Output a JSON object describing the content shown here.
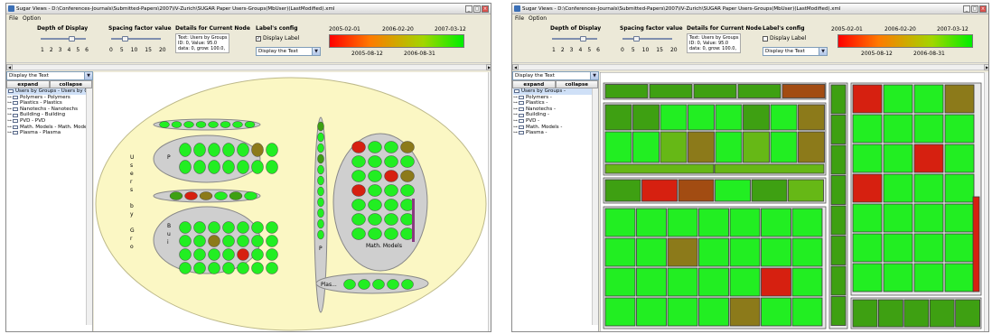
{
  "windows": [
    {
      "title": "Sugar Views - D:\\Conferences-Journals\\Submitted-Papers\\2007\\IV-Zurich\\SUGAR Paper Users-Groups(MbUser)(LastModified).xml",
      "menu": [
        "File",
        "Option"
      ],
      "depth": {
        "title": "Depth of Display",
        "ticks": [
          "1",
          "2",
          "3",
          "4",
          "5",
          "6"
        ],
        "value": 4
      },
      "spacing": {
        "title": "Spacing factor value",
        "ticks": [
          "0",
          "5",
          "10",
          "15",
          "20"
        ],
        "value": 5
      },
      "details": {
        "title": "Details for Current Node",
        "lines": [
          "Text: Users by Groups",
          "ID: 0, Value: 95.0",
          "data: 0, grow: 100.0,"
        ]
      },
      "label_config": {
        "title": "Label's config",
        "checkbox": "Display Label",
        "checked": true,
        "combo": "Display the Text"
      },
      "dates": {
        "top": [
          "2005-02-01",
          "2006-02-20",
          "2007-03-12"
        ],
        "bottom": [
          "2005-08-12",
          "2006-08-31"
        ]
      },
      "left_combo": "Display the Text",
      "expand": "expand",
      "collapse": "collapse",
      "tree": [
        "Users by Groups - Users by G",
        "Polymers - Polymers",
        "Plastics - Plastics",
        "Nanotechs - Nanotechs",
        "Building - Building",
        "PVD - PVD",
        "Math. Models - Math. Mode",
        "Plasma - Plasma"
      ],
      "canvas_labels": {
        "users_vertical": [
          "U",
          "s",
          "e",
          "r",
          "s",
          "",
          "b",
          "y",
          "",
          "G",
          "r",
          "o"
        ],
        "p_label": "P",
        "bui_label": [
          "B",
          "u",
          "i"
        ],
        "p_vert": "P",
        "math_label": "Math. Models",
        "plas_label": "Plas..."
      },
      "colors": {
        "green": "#22ee22",
        "darkgreen": "#3ea012",
        "olive": "#8c7a1a",
        "red": "#d62010",
        "ellipse": "#fbf7c4",
        "gray": "#cfcfcf"
      }
    },
    {
      "title": "Sugar Views - D:\\Conferences-Journals\\Submitted-Papers\\2007\\IV-Zurich\\SUGAR Paper Users-Groups(MbUser)(LastModified).xml",
      "menu": [
        "File",
        "Option"
      ],
      "depth": {
        "title": "Depth of Display",
        "ticks": [
          "1",
          "2",
          "3",
          "4",
          "5",
          "6"
        ],
        "value": 4
      },
      "spacing": {
        "title": "Spacing factor value",
        "ticks": [
          "0",
          "5",
          "10",
          "15",
          "20"
        ],
        "value": 5
      },
      "details": {
        "title": "Details for Current Node",
        "lines": [
          "Text: Users by Groups",
          "ID: 0, Value: 95.0",
          "data: 0, grow: 100.0,"
        ]
      },
      "label_config": {
        "title": "Label's config",
        "checkbox": "Display Label",
        "checked": false,
        "combo": "Display the Text"
      },
      "dates": {
        "top": [
          "2005-02-01",
          "2006-02-20",
          "2007-03-12"
        ],
        "bottom": [
          "2005-08-12",
          "2006-08-31"
        ]
      },
      "left_combo": "Display the Text",
      "expand": "expand",
      "collapse": "collapse",
      "tree": [
        "Users by Groups -",
        "Polymers -",
        "Plastics -",
        "Nanotechs -",
        "Building -",
        "PVD -",
        "Math. Models -",
        "Plasma -"
      ]
    }
  ]
}
